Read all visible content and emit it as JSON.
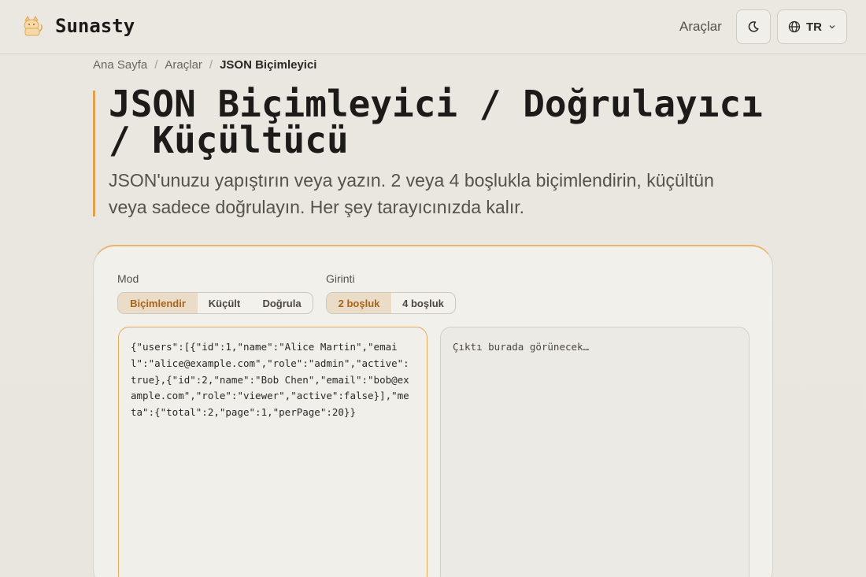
{
  "header": {
    "brand": "Sunasty",
    "nav_tools": "Araçlar",
    "language": "TR",
    "icons": {
      "logo": "cat-logo-icon",
      "theme": "moon-icon",
      "globe": "globe-icon",
      "chevron": "chevron-down-icon"
    }
  },
  "breadcrumb": {
    "items": [
      "Ana Sayfa",
      "Araçlar"
    ],
    "current": "JSON Biçimleyici",
    "separator": "/"
  },
  "hero": {
    "title": "JSON Biçimleyici / Doğrulayıcı / Küçültücü",
    "subtitle": "JSON'unuzu yapıştırın veya yazın. 2 veya 4 boşlukla biçimlendirin, küçültün veya sadece doğrulayın. Her şey tarayıcınızda kalır."
  },
  "controls": {
    "mode_label": "Mod",
    "modes": [
      "Biçimlendir",
      "Küçült",
      "Doğrula"
    ],
    "mode_selected": "Biçimlendir",
    "indent_label": "Girinti",
    "indents": [
      "2 boşluk",
      "4 boşluk"
    ],
    "indent_selected": "2 boşluk"
  },
  "editor": {
    "input_value": "{\"users\":[{\"id\":1,\"name\":\"Alice Martin\",\"email\":\"alice@example.com\",\"role\":\"admin\",\"active\":true},{\"id\":2,\"name\":\"Bob Chen\",\"email\":\"bob@example.com\",\"role\":\"viewer\",\"active\":false}],\"meta\":{\"total\":2,\"page\":1,\"perPage\":20}}",
    "output_placeholder": "Çıktı burada görünecek…"
  },
  "colors": {
    "accent": "#e2a14d",
    "active_text": "#a8641a",
    "active_bg": "#eadcc6",
    "background": "#ebe8e2"
  }
}
